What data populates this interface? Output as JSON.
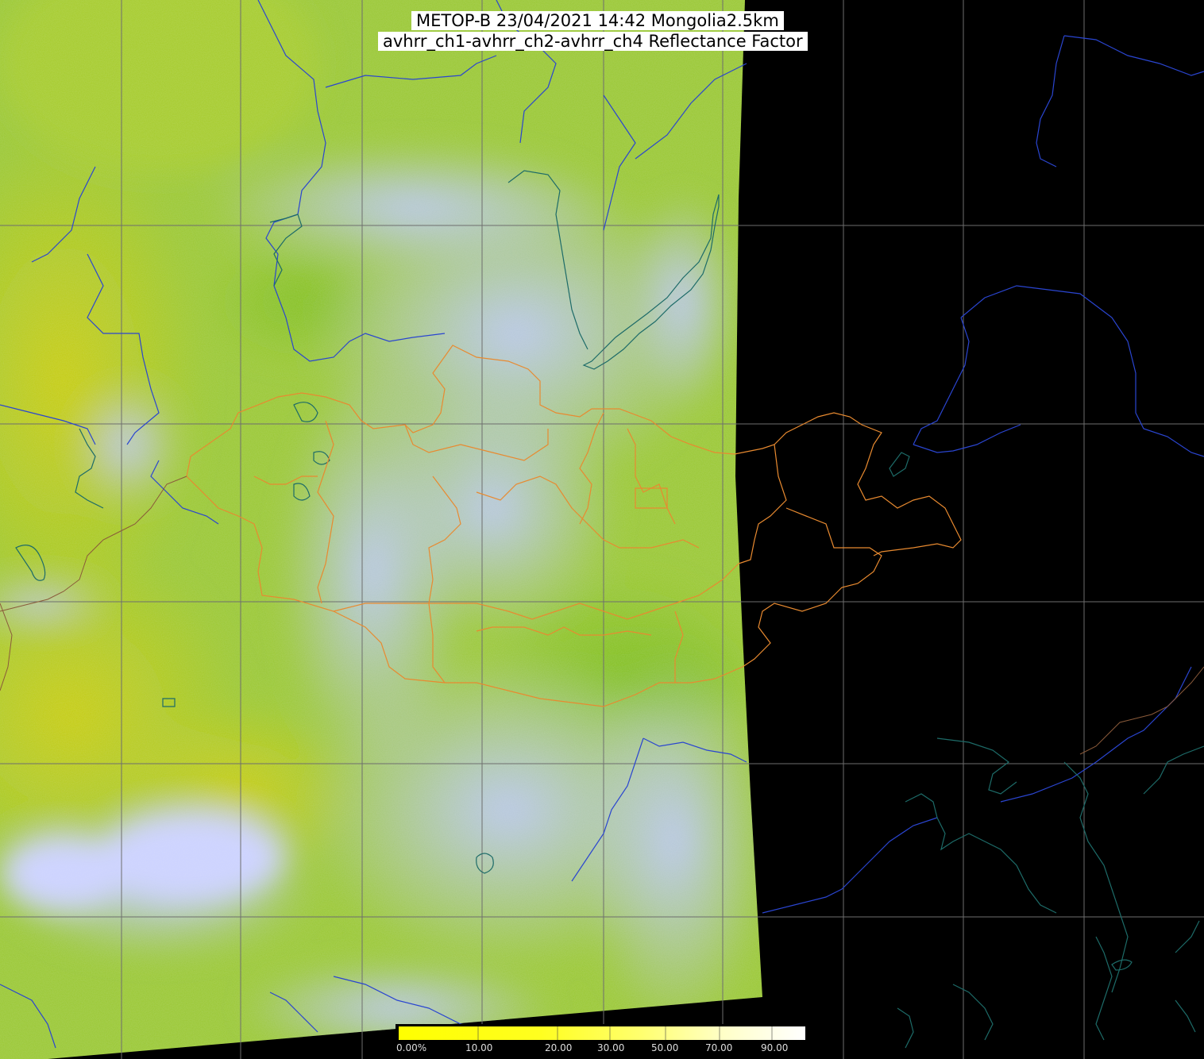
{
  "title": {
    "line1": "METOP-B 23/04/2021 14:42 Mongolia2.5km",
    "line2": "avhrr_ch1-avhrr_ch2-avhrr_ch4 Reflectance Factor"
  },
  "colorbar": {
    "labels": [
      "0.00%",
      "10.00",
      "20.00",
      "30.00",
      "50.00",
      "70.00",
      "90.00"
    ],
    "colors": [
      "#ffff00",
      "#fffe40",
      "#ffff90",
      "#ffffe0",
      "#ffffff"
    ]
  },
  "colors": {
    "background": "#000000",
    "land_green": "#8fc83a",
    "land_yellow": "#c8cc10",
    "cloud": "#b4c4f0",
    "grid": "#707070",
    "borders": "#e08a30",
    "rivers": "#3050d0",
    "coast": "#1f6a6a"
  }
}
